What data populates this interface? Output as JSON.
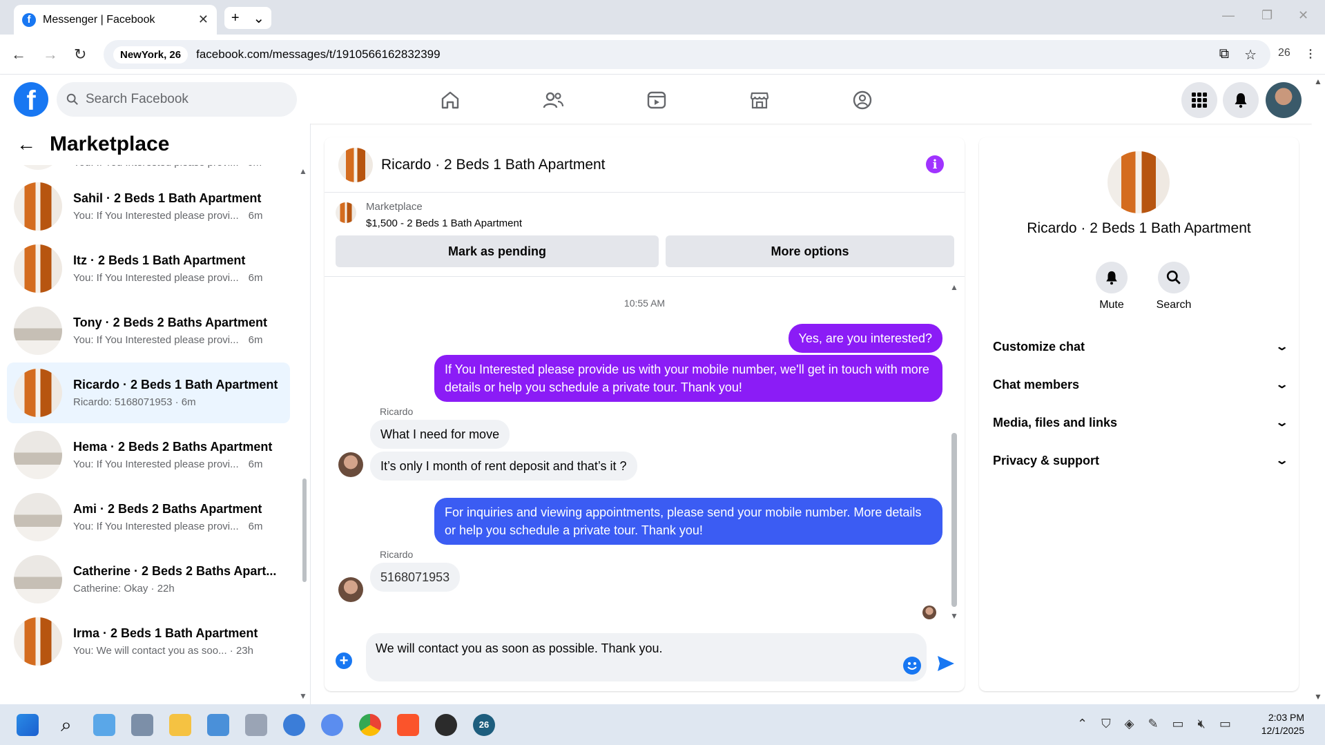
{
  "browser": {
    "tab_title": "Messenger | Facebook",
    "tab_close": "✕",
    "new_tab": "+",
    "tab_menu": "⌄",
    "location_chip": "NewYork, 26",
    "url": "facebook.com/messages/t/1910566162832399",
    "toolbar_badge": "26"
  },
  "facebook": {
    "logo": "f",
    "search_placeholder": "Search Facebook"
  },
  "left_panel": {
    "title": "Marketplace",
    "partial_top_preview": "You: If You Interested please provi...",
    "partial_top_time": "6m",
    "conversations": [
      {
        "name": "Sahil · 2 Beds 1 Bath Apartment",
        "preview": "You: If You Interested please provi...",
        "time": "6m",
        "thumb": "door"
      },
      {
        "name": "Itz · 2 Beds 1 Bath Apartment",
        "preview": "You: If You Interested please provi...",
        "time": "6m",
        "thumb": "door"
      },
      {
        "name": "Tony · 2 Beds 2 Baths Apartment",
        "preview": "You: If You Interested please provi...",
        "time": "6m",
        "thumb": "room"
      },
      {
        "name": "Ricardo · 2 Beds 1 Bath Apartment",
        "preview": "Ricardo: 5168071953 · 6m",
        "time": "",
        "thumb": "door",
        "active": true
      },
      {
        "name": "Hema · 2 Beds 2 Baths Apartment",
        "preview": "You: If You Interested please provi...",
        "time": "6m",
        "thumb": "room"
      },
      {
        "name": "Ami · 2 Beds 2 Baths Apartment",
        "preview": "You: If You Interested please provi...",
        "time": "6m",
        "thumb": "room"
      },
      {
        "name": "Catherine · 2 Beds 2 Baths Apart...",
        "preview": "Catherine: Okay · 22h",
        "time": "",
        "thumb": "room"
      },
      {
        "name": "Irma · 2 Beds 1 Bath Apartment",
        "preview": "You: We will contact you as soo... · 23h",
        "time": "",
        "thumb": "door"
      }
    ]
  },
  "chat": {
    "title": "Ricardo · 2 Beds 1 Bath Apartment",
    "info": "i",
    "listing_category": "Marketplace",
    "listing_price": "$1,500 - 2 Beds 1 Bath Apartment",
    "mark_pending": "Mark as pending",
    "more_options": "More options",
    "timestamp": "10:55 AM",
    "messages": [
      {
        "from": "me",
        "text": "Yes, are you interested?"
      },
      {
        "from": "me",
        "text": "If You Interested please provide us with your mobile number, we'll get in touch with more details or help you schedule a private tour. Thank you!"
      },
      {
        "from": "Ricardo",
        "text": "What I need for move"
      },
      {
        "from": "Ricardo",
        "text": "It’s only I month of rent deposit and that’s it ?"
      },
      {
        "from": "me",
        "text": "For inquiries and viewing appointments, please send your mobile number. More details or help you schedule a private tour. Thank you!"
      },
      {
        "from": "Ricardo",
        "text": "5168071953"
      }
    ],
    "sender_label": "Ricardo",
    "composer_text": "We will contact you as soon as possible. Thank you.",
    "add": "+"
  },
  "details": {
    "name": "Ricardo · 2 Beds 1 Bath Apartment",
    "mute": "Mute",
    "search": "Search",
    "sections": [
      "Customize chat",
      "Chat members",
      "Media, files and links",
      "Privacy & support"
    ]
  },
  "taskbar": {
    "time": "2:03 PM",
    "date": "12/1/2025",
    "app_badge": "26"
  },
  "colors": {
    "fb_blue": "#1877f2",
    "bubble_purple": "#8b1cf6",
    "bubble_blue": "#3b5cf3",
    "active_row": "#ebf5ff"
  }
}
